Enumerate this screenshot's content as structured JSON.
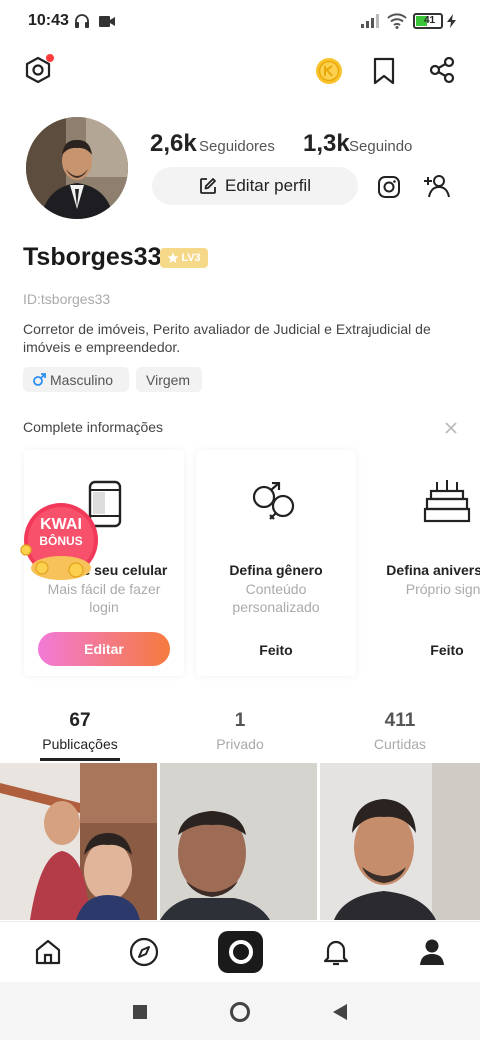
{
  "status": {
    "time": "10:43",
    "battery": "41"
  },
  "header": {
    "settings_icon": "hexagon-settings-icon",
    "coin_icon": "coin-icon",
    "bookmark_icon": "bookmark-icon",
    "share_icon": "share-icon"
  },
  "profile": {
    "followers_count": "2,6k",
    "followers_label": "Seguidores",
    "following_count": "1,3k",
    "following_label": "Seguindo",
    "edit_label": "Editar perfil",
    "username": "Tsborges33",
    "level": "LV3",
    "id": "ID:tsborges33",
    "bio": "Corretor de imóveis, Perito avaliador de Judicial e Extrajudicial de imóveis e empreendedor.",
    "tags": [
      "Masculino",
      "Virgem"
    ]
  },
  "complete": {
    "title": "Complete informações",
    "cards": [
      {
        "title": "Vincule seu celular",
        "sub": "Mais fácil de fazer login",
        "action": "Editar"
      },
      {
        "title": "Defina gênero",
        "sub": "Conteúdo personalizado",
        "action": "Feito"
      },
      {
        "title": "Defina aniversário",
        "sub": "Próprio signo",
        "action": "Feito"
      }
    ],
    "bonus_line1": "KWAI",
    "bonus_line2": "BÔNUS"
  },
  "tabs": [
    {
      "count": "67",
      "label": "Publicações",
      "active": true
    },
    {
      "count": "1",
      "label": "Privado"
    },
    {
      "count": "411",
      "label": "Curtidas"
    }
  ],
  "colors": {
    "accent_pink": "#f27ad7",
    "accent_orange": "#f57a3d",
    "notification_dot": "#ff3b3b"
  }
}
